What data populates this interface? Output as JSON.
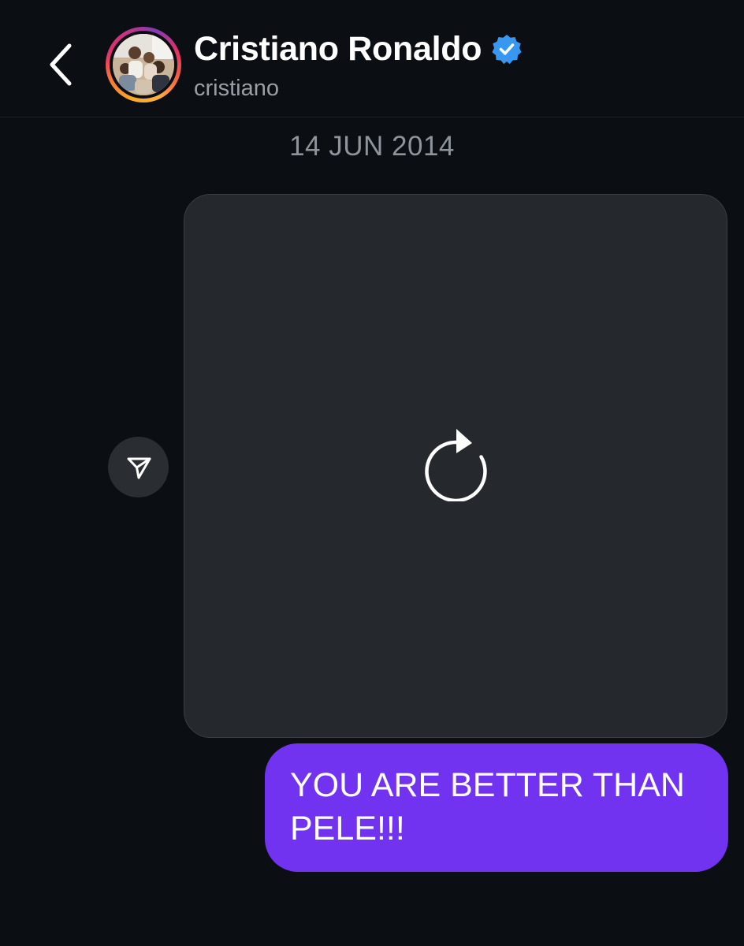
{
  "header": {
    "title": "Cristiano Ronaldo",
    "username": "cristiano",
    "verified": true,
    "icons": {
      "back": "chevron-left-icon",
      "verified": "verified-badge-icon"
    }
  },
  "conversation": {
    "date_separator": "14 JUN 2014",
    "messages": [
      {
        "type": "media",
        "state": "failed-to-load",
        "icons": {
          "reload": "reload-icon",
          "share": "send-icon"
        }
      },
      {
        "type": "text",
        "sender": "me",
        "text": "YOU ARE BETTER THAN PELE!!!"
      }
    ]
  },
  "colors": {
    "background": "#0b0e12",
    "media_card": "#25282d",
    "outgoing_bubble": "#7133f0",
    "verified_badge": "#3897f0",
    "muted_text": "#8e949b"
  }
}
